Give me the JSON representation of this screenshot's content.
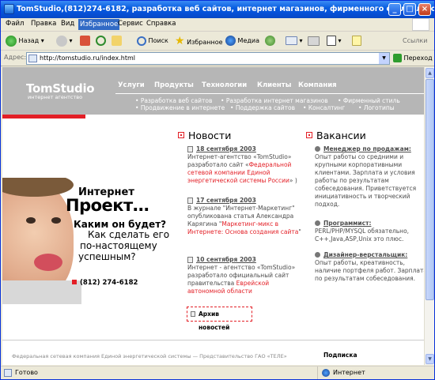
{
  "window": {
    "title": "TomStudio,(812)274-6182, разработка веб сайтов, интернет магазинов, фирменного стиля, логотипов - M..."
  },
  "menu": [
    "Файл",
    "Правка",
    "Вид",
    "Избранное",
    "Сервис",
    "Справка"
  ],
  "toolbar": {
    "back": "Назад",
    "search": "Поиск",
    "favorites": "Избранное",
    "media": "Медиа",
    "links": "Ссылки"
  },
  "address": {
    "label": "Адрес:",
    "url": "http://tomstudio.ru/index.html",
    "go": "Переход"
  },
  "site": {
    "logo": "TomStudio",
    "logo_sub": "интернет агентство",
    "nav": [
      "Услуги",
      "Продукты",
      "Технологии",
      "Клиенты",
      "Компания"
    ],
    "sub_row1": [
      "Разработка веб сайтов",
      "Разработка интернет магазинов",
      "Фирменный стиль"
    ],
    "sub_row2": [
      "Продвижение в интернете",
      "Поддержка сайтов",
      "Консалтинг",
      "Логотипы"
    ],
    "promo": {
      "line1": "Интернет",
      "line2": "Проект…",
      "line3": "Каким он будет?",
      "line4": "Как сделать его",
      "line5": "по-настоящему",
      "line6": "успешным?",
      "phone": "(812) 274-6182"
    },
    "news": {
      "title": "Новости",
      "items": [
        {
          "date": "18 сентября 2003",
          "text": "Интернет-агентство «TomStudio» разработало сайт «",
          "link": "Федеральной сетевой компании Единой энергетической системы России",
          "after": "» )"
        },
        {
          "date": "17 сентября 2003",
          "text": "В журнале \"Интернет-Маркетинг\" опубликована статья Александра Карягина \"",
          "link": "Маркетинг-микс в Интернете: Основа создания сайта",
          "after": "\""
        },
        {
          "date": "10 сентября 2003",
          "text": "Интернет - агентство «TomStudio» разработало официальный сайт правительства ",
          "link": "Еврейской автономной области",
          "after": ""
        }
      ],
      "archive": "Архив новостей"
    },
    "jobs": {
      "title": "Вакансии",
      "items": [
        {
          "title": "Менеджер по продажам:",
          "text": "Опыт работы со средними и крупными корпоративными клиентами. Зарплата и условия работы по результатам собеседования. Приветствуется инициативность и творческий подход."
        },
        {
          "title": "Программист:",
          "text": "PERL/PHP/MYSQL обязательно, C++,Java,ASP,Unix это плюс."
        },
        {
          "title": "Дизайнер-верстальщик:",
          "text": "Опыт работы, креативность, наличие портфеля работ. Зарплата по результатам собеседования."
        }
      ]
    },
    "footer": {
      "left": "Федеральная сетевая компания Единой энергетической системы — Представительство ГАО «ТЕЛЕ»",
      "right": "Подписка"
    }
  },
  "status": {
    "text": "Готово",
    "zone": "Интернет"
  }
}
